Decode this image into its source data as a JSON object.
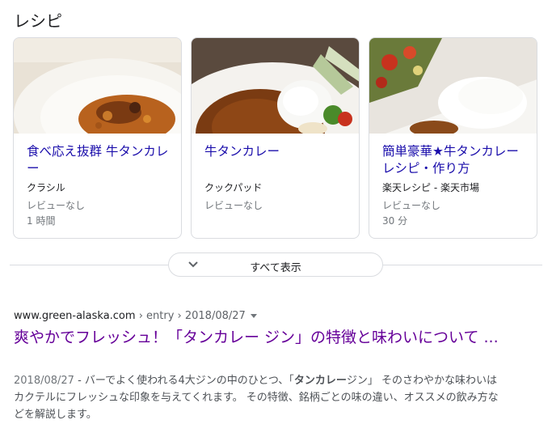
{
  "recipes": {
    "heading": "レシピ",
    "cards": [
      {
        "title": "食べ応え抜群 牛タンカレー",
        "source": "クラシル",
        "reviews": "レビューなし",
        "time": "1 時間"
      },
      {
        "title": "牛タンカレー",
        "source": "クックパッド",
        "reviews": "レビューなし",
        "time": ""
      },
      {
        "title": "簡単豪華★牛タンカレーレシピ・作り方",
        "source": "楽天レシピ - 楽天市場",
        "reviews": "レビューなし",
        "time": "30 分"
      }
    ],
    "show_all": "すべて表示"
  },
  "result": {
    "domain": "www.green-alaska.com",
    "path": " › entry › 2018/08/27",
    "title": "爽やかでフレッシュ！「タンカレー ジン」の特徴と味わいについて ...",
    "date": "2018/08/27",
    "snippet_before": " - バーでよく使われる4大ジンの中のひとつ、「",
    "snippet_bold": "タンカレー",
    "snippet_after": "ジン」 そのさわやかな味わいはカクテルにフレッシュな印象を与えてくれます。 その特徴、銘柄ごとの味の違い、オススメの飲み方などを解説します。"
  },
  "colors": {
    "link": "#1a0dab",
    "visited": "#660099",
    "muted": "#70757a",
    "border": "#dadce0"
  }
}
